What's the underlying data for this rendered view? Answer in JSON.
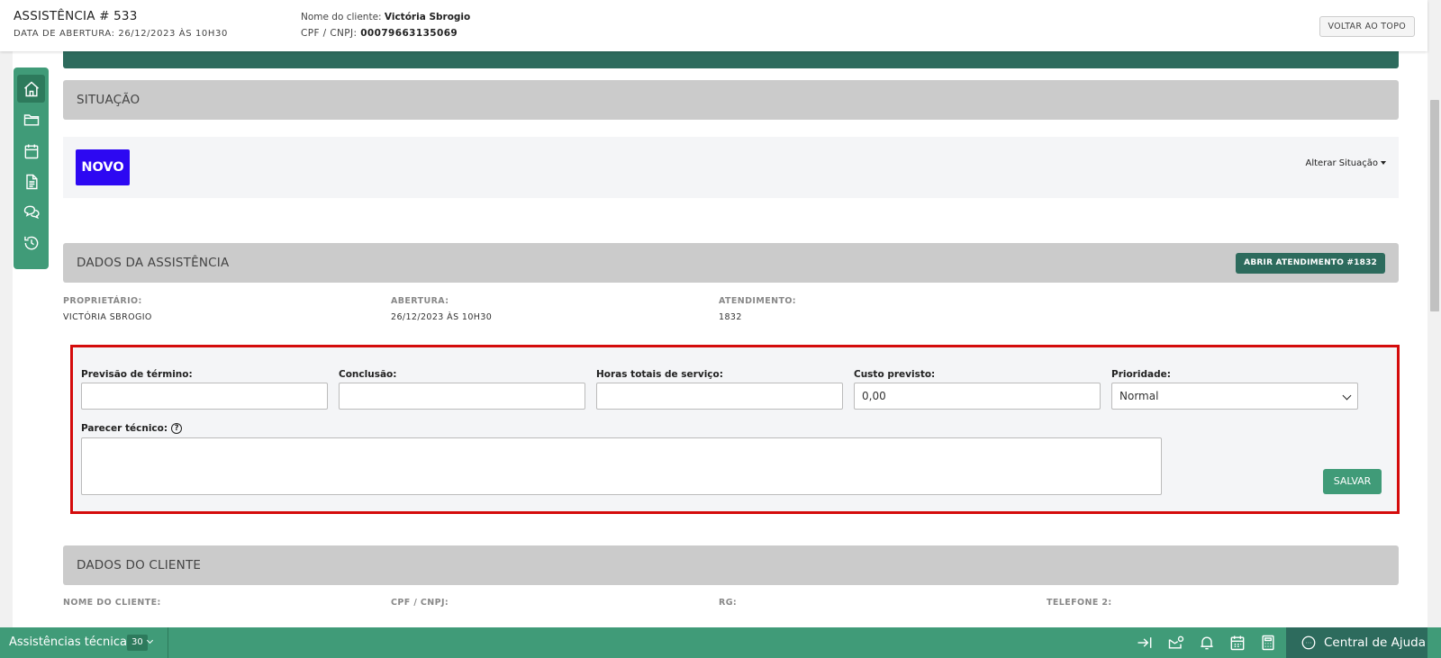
{
  "header": {
    "title": "ASSISTÊNCIA # 533",
    "opening_date": "DATA DE ABERTURA: 26/12/2023 ÀS 10H30",
    "client_label": "Nome do cliente:",
    "client_name": "Victória Sbrogio",
    "cpf_label": "CPF / CNPJ:",
    "cpf_value": "00079663135069",
    "back_to_top": "VOLTAR AO TOPO"
  },
  "sidebar": {
    "icons": [
      "home-icon",
      "folder-icon",
      "calendar-icon",
      "document-icon",
      "chat-icon",
      "history-icon"
    ]
  },
  "situacao": {
    "heading": "SITUAÇÃO",
    "status_badge": "NOVO",
    "status_color": "#2d08f2",
    "change_status": "Alterar Situação"
  },
  "dados_assistencia": {
    "heading": "DADOS DA ASSISTÊNCIA",
    "open_ticket_button": "ABRIR ATENDIMENTO #1832",
    "owner_label": "PROPRIETÁRIO:",
    "owner_value": "VICTÓRIA SBROGIO",
    "opening_label": "ABERTURA:",
    "opening_value": "26/12/2023 ÀS 10H30",
    "ticket_label": "ATENDIMENTO:",
    "ticket_value": "1832"
  },
  "form": {
    "previsao_label": "Previsão de término:",
    "previsao_value": "",
    "conclusao_label": "Conclusão:",
    "conclusao_value": "",
    "horas_label": "Horas totais de serviço:",
    "horas_value": "",
    "custo_label": "Custo previsto:",
    "custo_value": "0,00",
    "prioridade_label": "Prioridade:",
    "prioridade_value": "Normal",
    "parecer_label": "Parecer técnico:",
    "save_button": "SALVAR"
  },
  "dados_cliente": {
    "heading": "DADOS DO CLIENTE",
    "name_label": "NOME DO CLIENTE:",
    "cpf_label": "CPF / CNPJ:",
    "rg_label": "RG:",
    "phone2_label": "TELEFONE 2:"
  },
  "bottom_bar": {
    "module_label": "Assistências técnicas",
    "count": "30",
    "help_label": "Central de Ajuda"
  },
  "colors": {
    "accent_green": "#409b78",
    "dark_green": "#2d6b5d",
    "highlight_red": "#d40b0b"
  }
}
